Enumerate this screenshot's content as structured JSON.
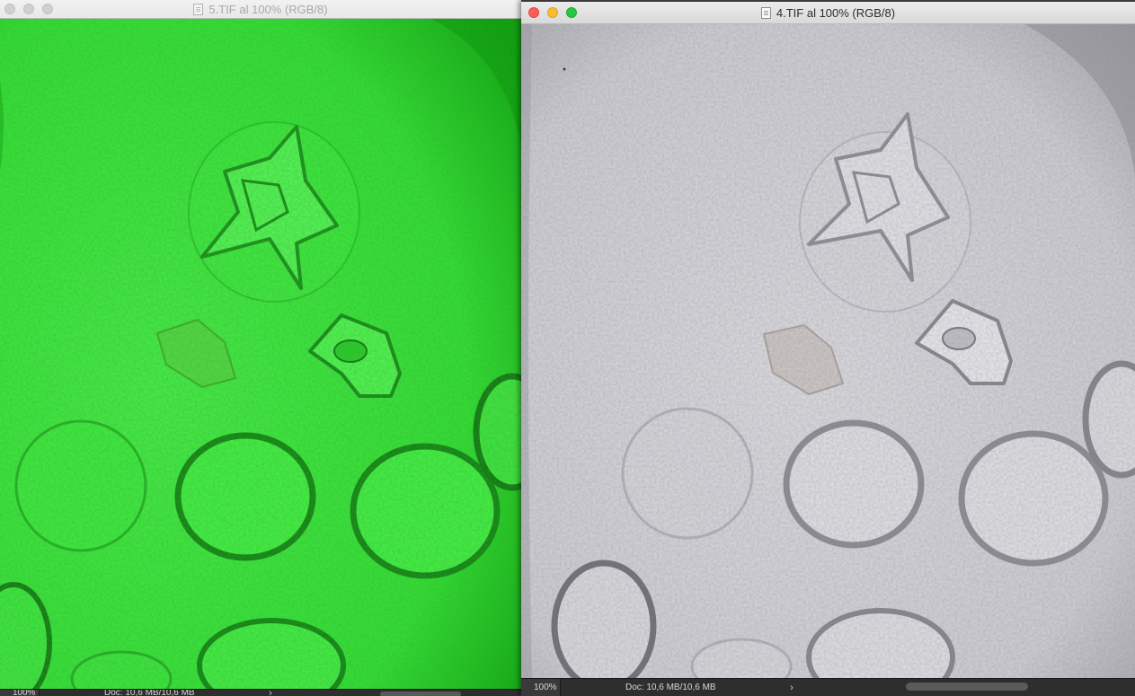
{
  "windows": {
    "left": {
      "title": "5.TIF al 100% (RGB/8)",
      "zoom": "100%",
      "doc_size": "Doc: 10,6 MB/10,6 MB",
      "arrow": "›"
    },
    "right": {
      "title": "4.TIF al 100% (RGB/8)",
      "zoom": "100%",
      "doc_size": "Doc: 10,6 MB/10,6 MB",
      "arrow": "›"
    }
  },
  "colors": {
    "left_canvas": "#2fe02f",
    "right_canvas": "#cfcfd3"
  },
  "icons": {
    "document": "document-icon"
  }
}
